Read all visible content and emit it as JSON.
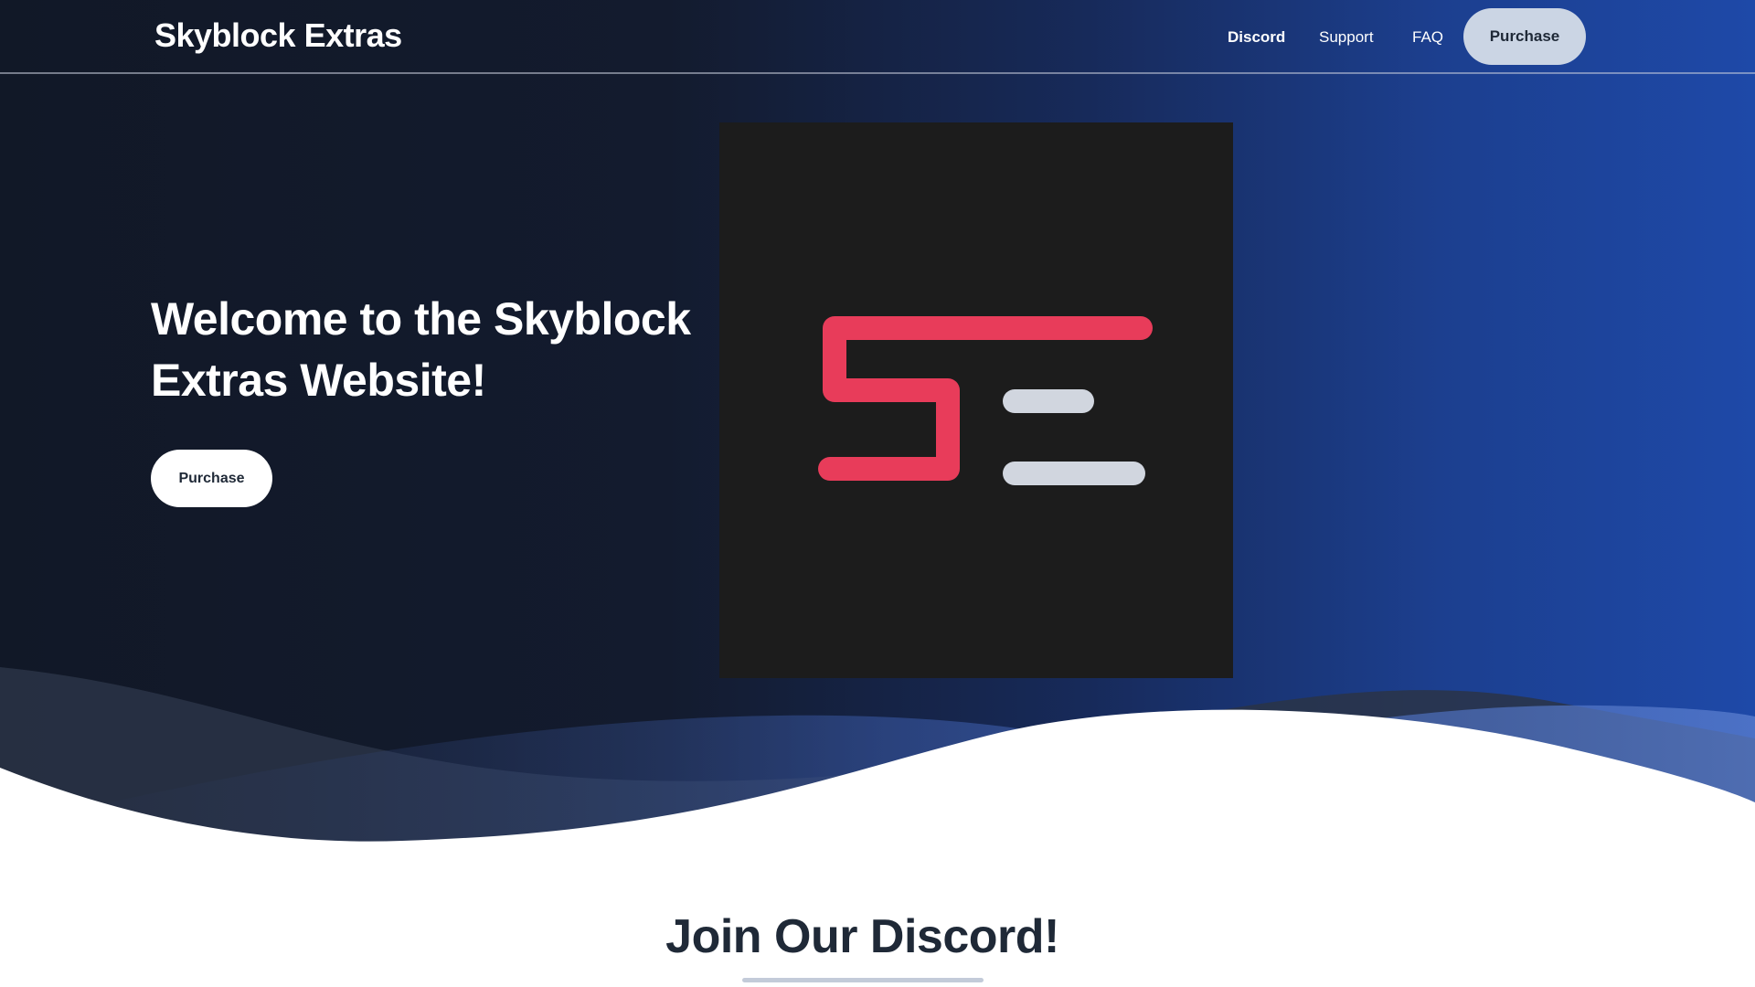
{
  "nav": {
    "brand": "Skyblock Extras",
    "links": [
      "Discord",
      "Support",
      "FAQ"
    ],
    "purchase_label": "Purchase"
  },
  "hero": {
    "title": "Welcome to the Skyblock Extras Website!",
    "purchase_label": "Purchase",
    "logo": {
      "icon": "se-logo",
      "accent_color": "#e83c5a",
      "bar_color": "#d1d6df",
      "background": "#1c1c1c"
    }
  },
  "discord_section": {
    "title": "Join Our Discord!"
  },
  "colors": {
    "hero_dark": "#111827",
    "hero_blue": "#1e49a8",
    "nav_button": "#cbd5e4",
    "text_dark": "#1f2937"
  }
}
